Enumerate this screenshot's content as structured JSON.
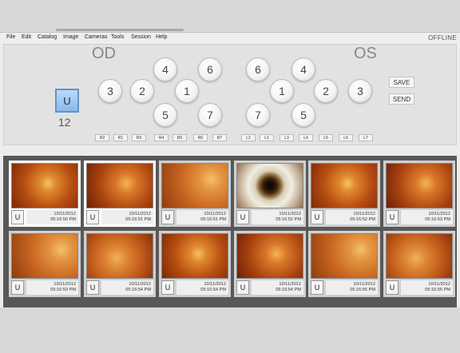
{
  "menu": {
    "items": [
      "File",
      "Edit",
      "Catalog",
      "Image",
      "Cameras",
      "Tools",
      "Session",
      "Help"
    ],
    "status": "OFFLINE"
  },
  "eyes": {
    "left_label": "OD",
    "right_label": "OS"
  },
  "u_button": {
    "label": "U",
    "count": "12"
  },
  "od_fields": [
    "4",
    "6",
    "3",
    "2",
    "1",
    "5",
    "7"
  ],
  "os_fields": [
    "6",
    "4",
    "1",
    "2",
    "3",
    "7",
    "5"
  ],
  "actions": {
    "save": "SAVE",
    "send": "SEND"
  },
  "small_buttons": [
    "R2",
    "R1",
    "R3",
    "R4",
    "R5",
    "R6",
    "R7",
    "L2",
    "L1",
    "L3",
    "L4",
    "L5",
    "L6",
    "L7"
  ],
  "thumbnails": [
    {
      "u": "U",
      "date": "10/11/2012",
      "time": "05:16:50 PM",
      "kind": "fundus",
      "selected": true
    },
    {
      "u": "U",
      "date": "10/11/2012",
      "time": "05:16:51 PM",
      "kind": "fundus",
      "selected": true
    },
    {
      "u": "U",
      "date": "10/11/2012",
      "time": "05:16:51 PM",
      "kind": "fundus",
      "selected": false
    },
    {
      "u": "U",
      "date": "10/11/2012",
      "time": "05:16:52 PM",
      "kind": "eye",
      "selected": false
    },
    {
      "u": "U",
      "date": "10/11/2012",
      "time": "05:16:52 PM",
      "kind": "fundus",
      "selected": false
    },
    {
      "u": "U",
      "date": "10/11/2012",
      "time": "05:16:53 PM",
      "kind": "fundus",
      "selected": false
    },
    {
      "u": "U",
      "date": "10/11/2012",
      "time": "05:16:53 PM",
      "kind": "fundus",
      "selected": false
    },
    {
      "u": "U",
      "date": "10/11/2012",
      "time": "05:16:54 PM",
      "kind": "fundus",
      "selected": false
    },
    {
      "u": "U",
      "date": "10/11/2012",
      "time": "05:16:54 PM",
      "kind": "fundus",
      "selected": false
    },
    {
      "u": "U",
      "date": "10/11/2012",
      "time": "05:16:54 PM",
      "kind": "fundus",
      "selected": false
    },
    {
      "u": "U",
      "date": "10/11/2012",
      "time": "05:16:55 PM",
      "kind": "fundus",
      "selected": false
    },
    {
      "u": "U",
      "date": "10/11/2012",
      "time": "05:16:55 PM",
      "kind": "fundus",
      "selected": false
    }
  ],
  "colors": {
    "accent": "#8ab9ec",
    "fundus": "#d8701e",
    "gallery_bg": "#585858"
  }
}
